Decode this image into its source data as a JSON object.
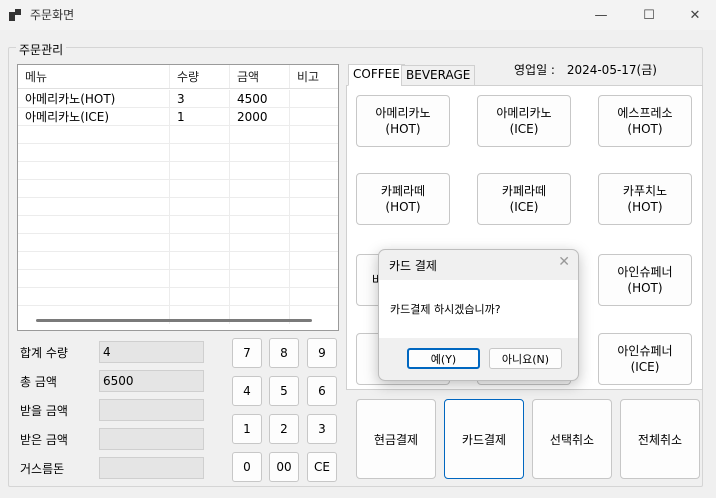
{
  "window": {
    "title": "주문화면",
    "minimize": "—",
    "maximize": "☐",
    "close": "✕"
  },
  "group_label": "주문관리",
  "grid": {
    "columns": [
      "메뉴",
      "수량",
      "금액",
      "비고"
    ],
    "rows": [
      [
        "아메리카노(HOT)",
        "3",
        "4500",
        ""
      ],
      [
        "아메리카노(ICE)",
        "1",
        "2000",
        ""
      ]
    ]
  },
  "summary": {
    "total_qty_label": "합계 수량",
    "total_qty": "4",
    "total_amount_label": "총 금액",
    "total_amount": "6500",
    "to_receive_label": "받을 금액",
    "to_receive": "",
    "received_label": "받은 금액",
    "received": "",
    "change_label": "거스름돈",
    "change": ""
  },
  "keypad": [
    "7",
    "8",
    "9",
    "4",
    "5",
    "6",
    "1",
    "2",
    "3",
    "0",
    "00",
    "CE"
  ],
  "tabs": [
    "COFFEE",
    "BEVERAGE"
  ],
  "business_date_label": "영업일 :",
  "business_date": "2024-05-17(금)",
  "menu_buttons": [
    [
      "아메리카노",
      "(HOT)"
    ],
    [
      "아메리카노",
      "(ICE)"
    ],
    [
      "에스프레소",
      "(HOT)"
    ],
    [
      "카페라떼",
      "(HOT)"
    ],
    [
      "카페라떼",
      "(ICE)"
    ],
    [
      "카푸치노",
      "(HOT)"
    ],
    [
      "바",
      ""
    ],
    [
      "아인슈페너",
      "(HOT)"
    ],
    [
      "아인슈페너",
      "(ICE)"
    ]
  ],
  "pay_buttons": [
    "현금결제",
    "카드결제",
    "선택취소",
    "전체취소"
  ],
  "dialog": {
    "title": "카드 결제",
    "message": "카드결제 하시겠습니까?",
    "yes": "예(Y)",
    "no": "아니요(N)",
    "close": "✕"
  }
}
